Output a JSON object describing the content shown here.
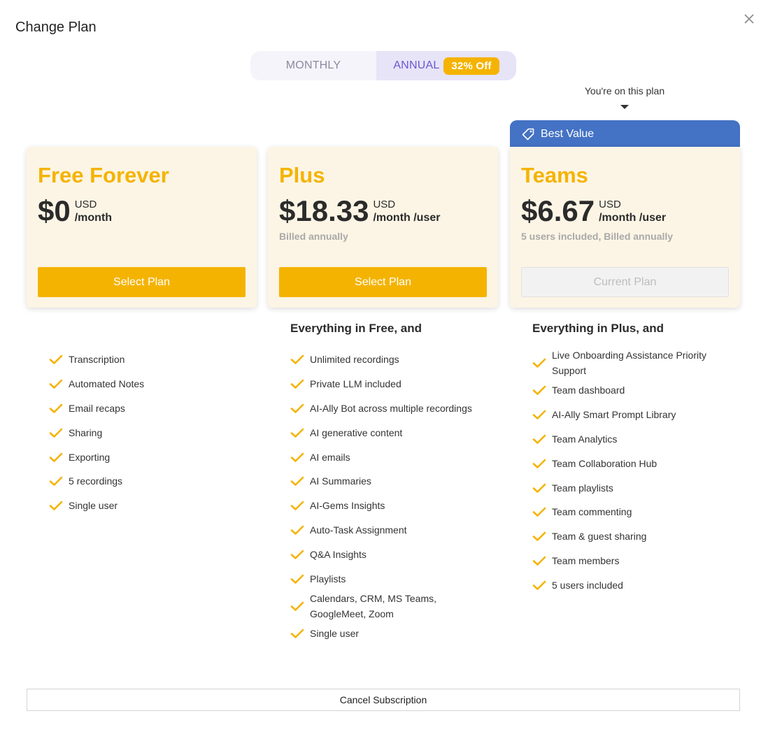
{
  "dialog": {
    "title": "Change Plan"
  },
  "toggle": {
    "monthly_label": "MONTHLY",
    "annual_label": "ANNUAL",
    "discount_badge": "32% Off",
    "active": "annual"
  },
  "current_plan_note": "You're on this plan",
  "best_value_label": "Best Value",
  "plans": [
    {
      "name": "Free Forever",
      "price": "$0",
      "currency": "USD",
      "period": "/month",
      "billing": "",
      "button_label": "Select Plan",
      "button_state": "enabled",
      "features_heading": "",
      "features": [
        "Transcription",
        "Automated Notes",
        "Email recaps",
        "Sharing",
        "Exporting",
        "5 recordings",
        "Single user"
      ]
    },
    {
      "name": "Plus",
      "price": "$18.33",
      "currency": "USD",
      "period": "/month /user",
      "billing": "Billed annually",
      "button_label": "Select Plan",
      "button_state": "enabled",
      "features_heading": "Everything in Free, and",
      "features": [
        "Unlimited recordings",
        "Private LLM included",
        "AI-Ally Bot across multiple recordings",
        "AI generative content",
        "AI emails",
        "AI Summaries",
        "AI-Gems Insights",
        "Auto-Task Assignment",
        "Q&A Insights",
        "Playlists",
        "Calendars, CRM, MS Teams, GoogleMeet, Zoom",
        "Single user"
      ]
    },
    {
      "name": "Teams",
      "price": "$6.67",
      "currency": "USD",
      "period": "/month /user",
      "billing": "5 users included, Billed annually",
      "button_label": "Current Plan",
      "button_state": "disabled",
      "features_heading": "Everything in Plus, and",
      "features": [
        "Live Onboarding Assistance Priority Support",
        "Team dashboard",
        "AI-Ally Smart Prompt Library",
        "Team Analytics",
        "Team Collaboration Hub",
        "Team playlists",
        "Team commenting",
        "Team & guest sharing",
        "Team members",
        "5 users included"
      ]
    }
  ],
  "cancel_label": "Cancel Subscription",
  "colors": {
    "accent": "#f5b301",
    "card_bg": "#fcf5e5",
    "best_value_bg": "#4472c4",
    "toggle_active": "#6e56cf"
  }
}
